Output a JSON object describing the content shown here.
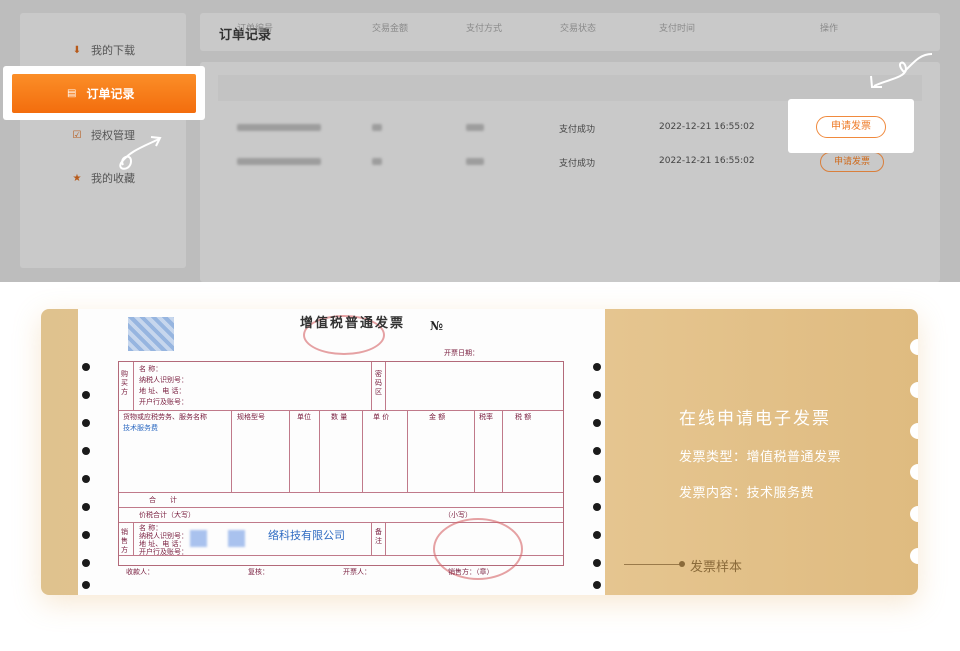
{
  "sidebar": {
    "items": [
      {
        "icon": "download-icon",
        "label": "我的下载"
      },
      {
        "icon": "document-icon",
        "label": "订单记录",
        "active": true
      },
      {
        "icon": "check-square-icon",
        "label": "授权管理"
      },
      {
        "icon": "star-icon",
        "label": "我的收藏"
      }
    ]
  },
  "header": {
    "title": "订单记录"
  },
  "table": {
    "columns": [
      "订单编号",
      "交易金额",
      "支付方式",
      "交易状态",
      "支付时间",
      "操作"
    ],
    "rows": [
      {
        "status": "支付成功",
        "time": "2022-12-21 16:55:02",
        "action": "申请发票"
      },
      {
        "status": "支付成功",
        "time": "2022-12-21 16:55:02",
        "action": "申请发票"
      }
    ]
  },
  "invoice": {
    "title": "增值税普通发票",
    "number_prefix": "№",
    "date_label": "开票日期：",
    "buyer": {
      "side": "购买方",
      "name": "名 称：",
      "tax_id": "纳税人识别号：",
      "addr": "地 址、电 话：",
      "bank": "开户行及账号："
    },
    "cipher_label": "密码区",
    "items_header": [
      "货物或应税劳务、服务名称",
      "规格型号",
      "单位",
      "数 量",
      "单 价",
      "金 额",
      "税率",
      "税 额"
    ],
    "item_name": "技术服务费",
    "total_label": "合　　计",
    "amount_words_label": "价税合计（大写）",
    "amount_small_label": "（小写）",
    "seller": {
      "side": "销售方",
      "name": "名 称：",
      "tax_id": "纳税人识别号：",
      "addr": "地 址、电 话：",
      "bank": "开户行及账号："
    },
    "seller_company": "络科技有限公司",
    "remark_label": "备注",
    "footer": [
      "收款人：",
      "复核：",
      "开票人：",
      "销售方：（章）"
    ]
  },
  "info": {
    "title": "在线申请电子发票",
    "type_line": "发票类型：增值税普通发票",
    "content_line": "发票内容：技术服务费",
    "sample_label": "发票样本"
  },
  "colors": {
    "accent": "#f36d0d",
    "banner": "#e2c18c"
  }
}
